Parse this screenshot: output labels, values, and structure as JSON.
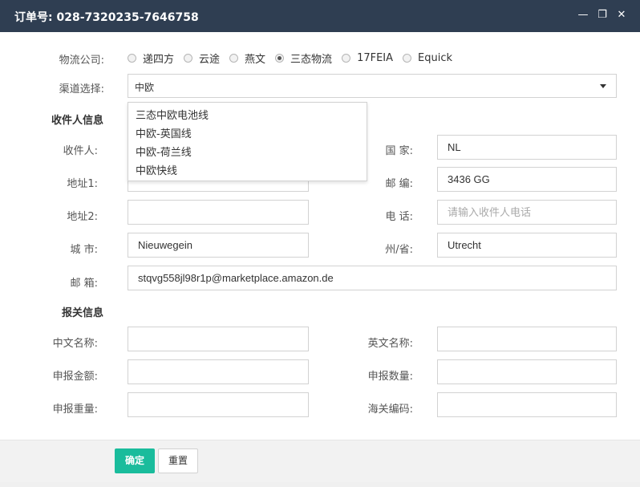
{
  "title": "订单号: 028-7320235-7646758",
  "window_controls": {
    "minimize": "—",
    "restore": "❐",
    "close": "✕"
  },
  "logistics": {
    "label": "物流公司:",
    "options": [
      "递四方",
      "云途",
      "燕文",
      "三态物流",
      "17FEIA",
      "Equick"
    ],
    "selected": "三态物流"
  },
  "channel": {
    "label": "渠道选择:",
    "value": "中欧",
    "dropdown": [
      "三态中欧电池线",
      "中欧-英国线",
      "中欧-荷兰线",
      "中欧快线"
    ]
  },
  "recipient": {
    "section": "收件人信息",
    "name_label": "收件人:",
    "name_value": "",
    "country_label": "国 家:",
    "country_value": "NL",
    "addr1_label": "地址1:",
    "addr1_value": "",
    "zip_label": "邮 编:",
    "zip_value": "3436 GG",
    "addr2_label": "地址2:",
    "addr2_value": "",
    "phone_label": "电 话:",
    "phone_placeholder": "请输入收件人电话",
    "city_label": "城 市:",
    "city_value": "Nieuwegein",
    "state_label": "州/省:",
    "state_value": "Utrecht",
    "email_label": "邮 箱:",
    "email_value": "stqvg558jl98r1p@marketplace.amazon.de"
  },
  "customs": {
    "section": "报关信息",
    "cn_name_label": "中文名称:",
    "en_name_label": "英文名称:",
    "amount_label": "申报金额:",
    "qty_label": "申报数量:",
    "weight_label": "申报重量:",
    "hs_label": "海关编码:"
  },
  "buttons": {
    "confirm": "确定",
    "reset": "重置"
  }
}
